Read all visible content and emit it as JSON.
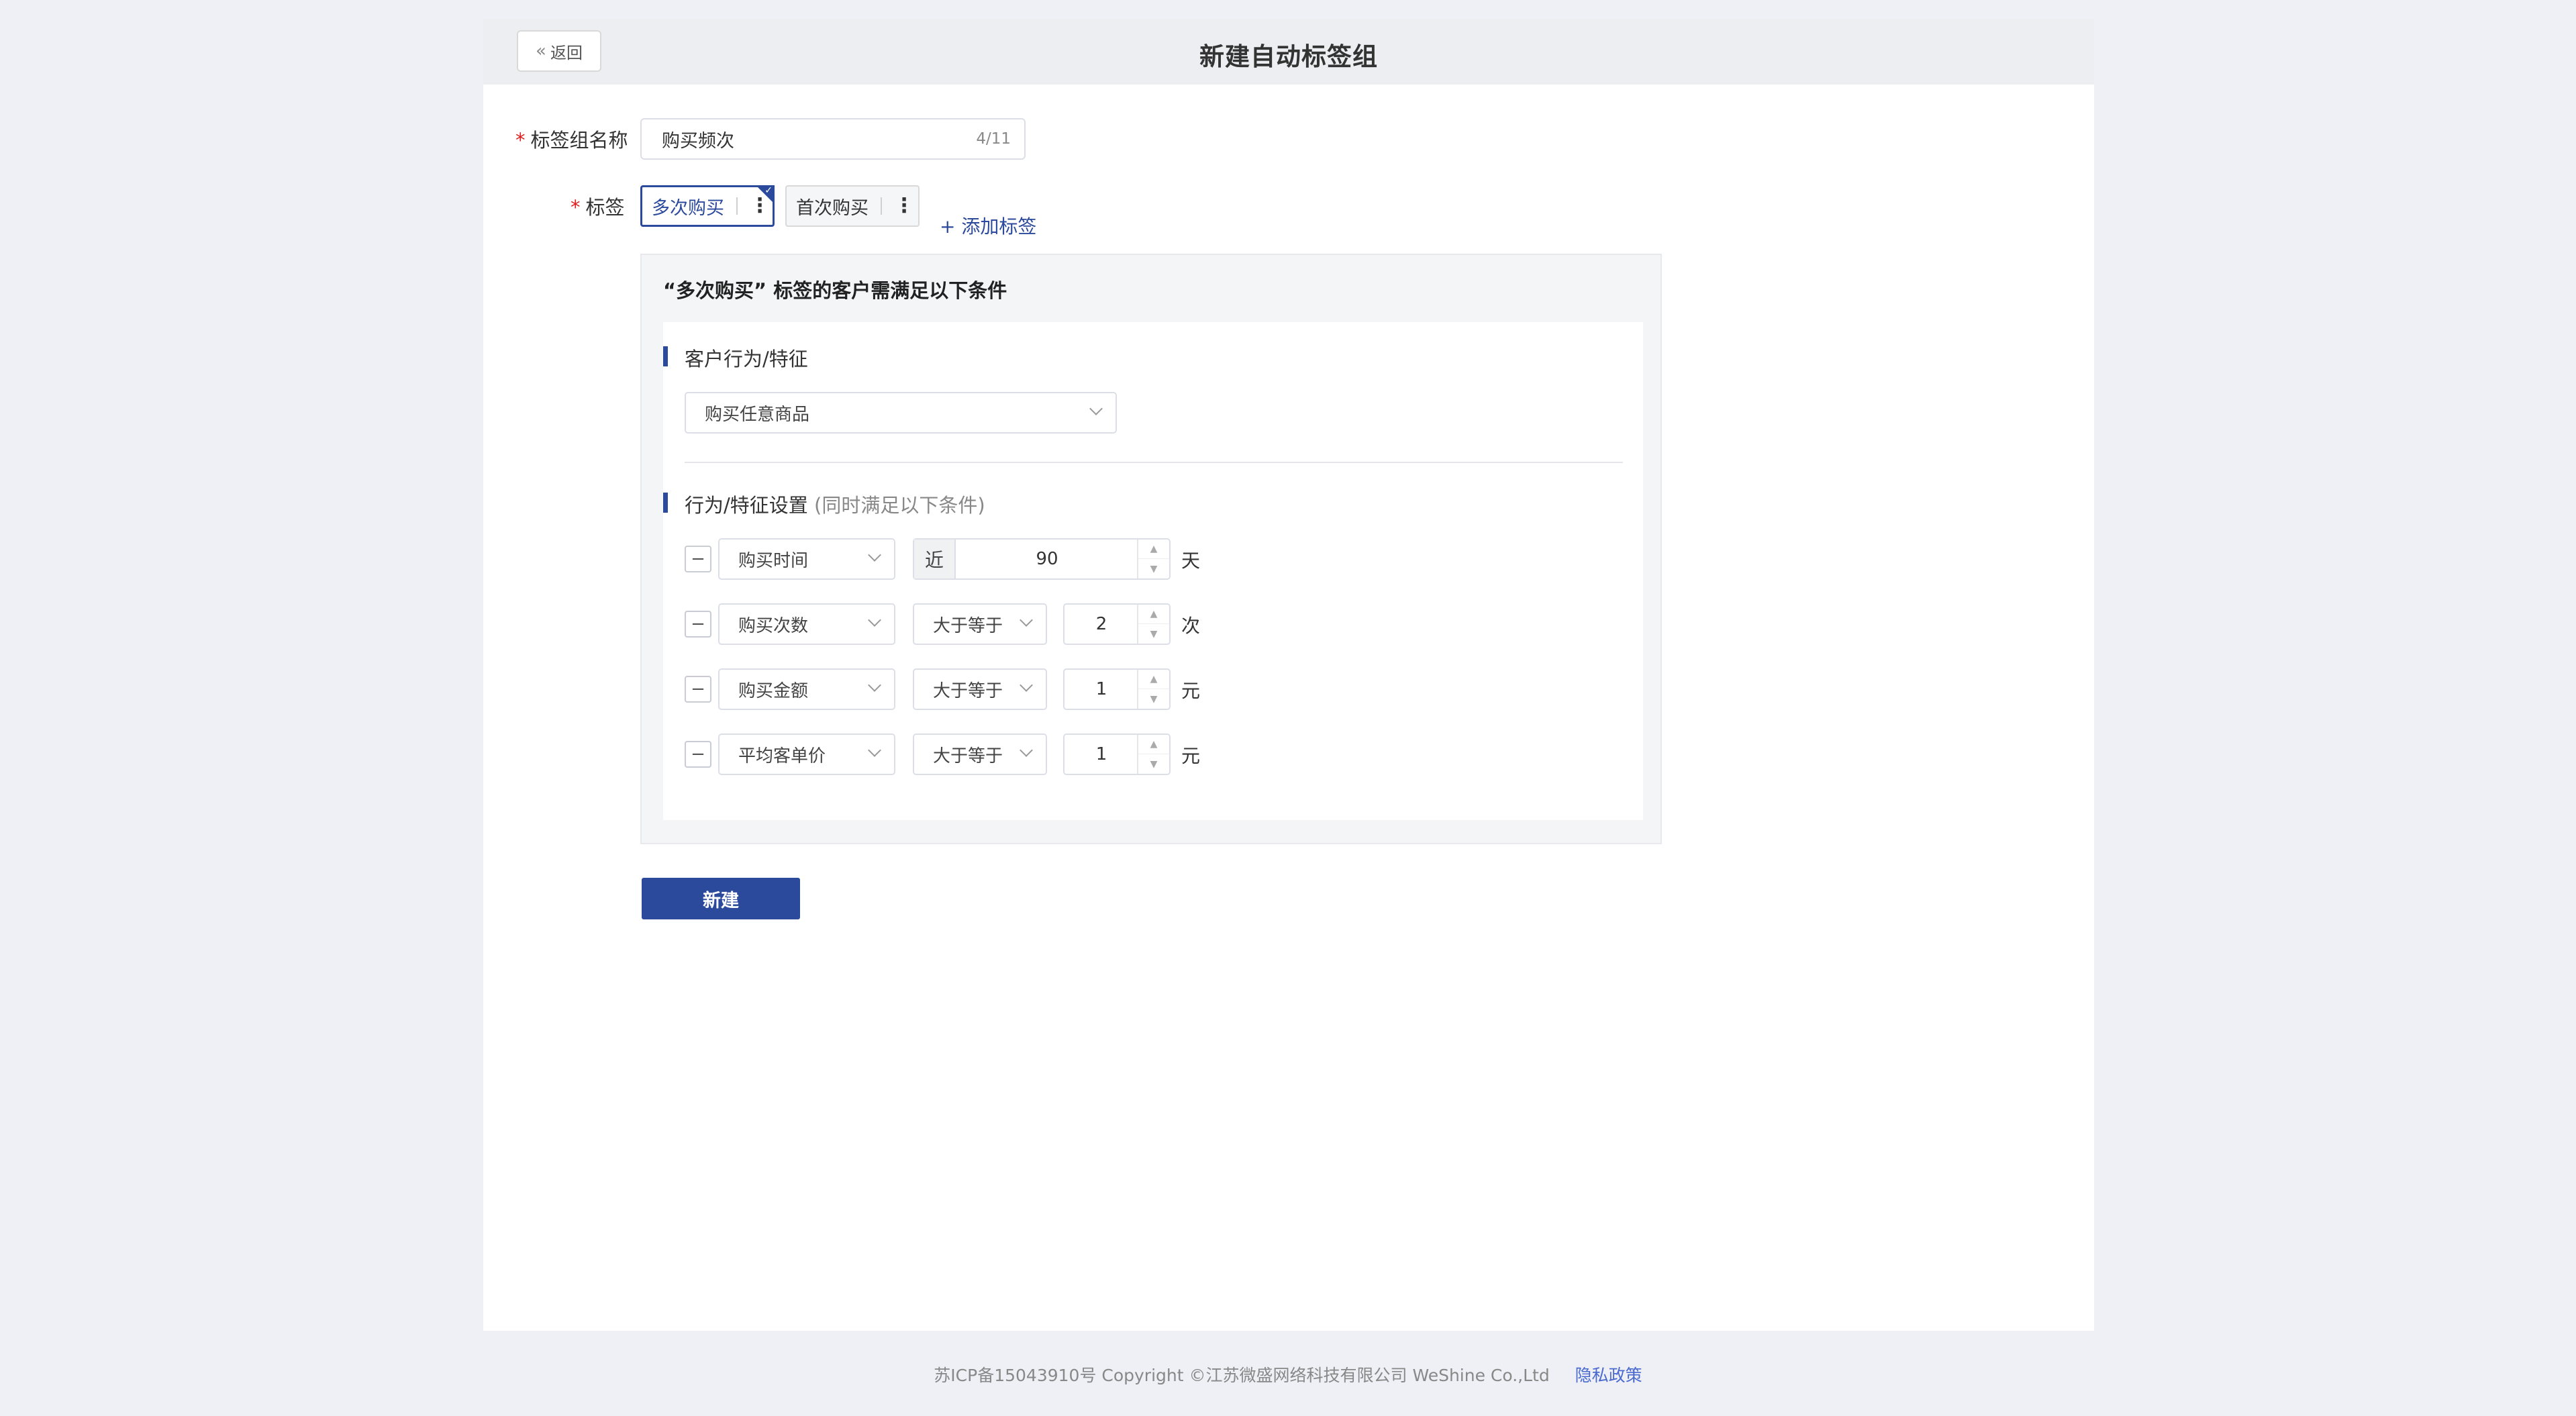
{
  "header": {
    "back_label": "返回",
    "title": "新建自动标签组"
  },
  "form": {
    "name_label": "标签组名称",
    "name_value": "购买频次",
    "name_count": "4/11",
    "tags_label": "标签",
    "tags": [
      {
        "label": "多次购买",
        "active": true
      },
      {
        "label": "首次购买",
        "active": false
      }
    ],
    "add_tag_label": "+ 添加标签"
  },
  "condition": {
    "title": "“多次购买” 标签的客户需满足以下条件",
    "behavior_section_title": "客户行为/特征",
    "behavior_select": "购买任意商品",
    "settings_section_title": "行为/特征设置",
    "settings_section_hint": "(同时满足以下条件)",
    "rows": [
      {
        "field": "购买时间",
        "prefix": "近",
        "value": "90",
        "unit": "天"
      },
      {
        "field": "购买次数",
        "operator": "大于等于",
        "value": "2",
        "unit": "次"
      },
      {
        "field": "购买金额",
        "operator": "大于等于",
        "value": "1",
        "unit": "元"
      },
      {
        "field": "平均客单价",
        "operator": "大于等于",
        "value": "1",
        "unit": "元"
      }
    ],
    "minus_symbol": "−"
  },
  "actions": {
    "create_label": "新建"
  },
  "footer": {
    "copyright": "苏ICP备15043910号 Copyright ©江苏微盛网络科技有限公司 WeShine Co.,Ltd",
    "privacy_label": "隐私政策"
  },
  "colors": {
    "primary": "#2c4a9c",
    "page_bg": "#eef0f5",
    "required": "#e02020"
  }
}
